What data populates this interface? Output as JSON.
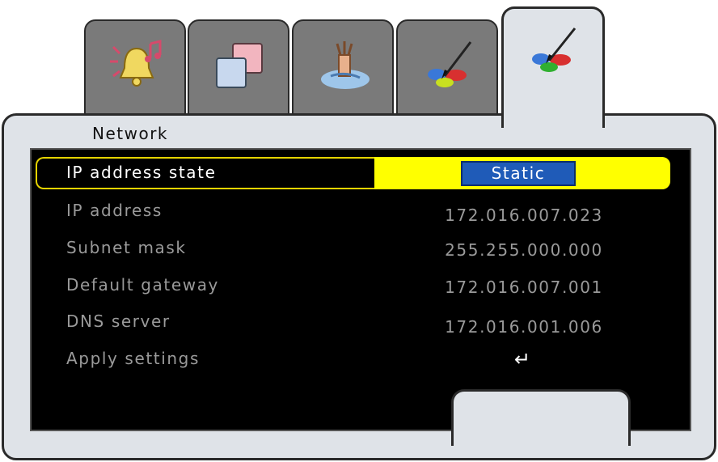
{
  "tabs": [
    {
      "icon": "alarm-bell-icon",
      "active": false
    },
    {
      "icon": "display-squares-icon",
      "active": false
    },
    {
      "icon": "water-hand-icon",
      "active": false
    },
    {
      "icon": "paint-brush-icon",
      "active": false
    },
    {
      "icon": "paint-brush-icon",
      "active": true
    }
  ],
  "panel": {
    "title": "Network"
  },
  "rows": [
    {
      "label": "IP address state",
      "value": "Static",
      "selected": true
    },
    {
      "label": "IP address",
      "value": "172.016.007.023"
    },
    {
      "label": "Subnet mask",
      "value": "255.255.000.000"
    },
    {
      "label": "Default gateway",
      "value": "172.016.007.001"
    },
    {
      "label": "DNS server",
      "value": "172.016.001.006"
    },
    {
      "label": "Apply settings",
      "value": "↵"
    }
  ],
  "colors": {
    "highlight": "#ffff00",
    "selected_button": "#1f5bb8",
    "panel": "#dfe3e8",
    "tab_inactive": "#7a7a7a",
    "screen": "#000000",
    "text_dim": "#9a9a9a"
  }
}
